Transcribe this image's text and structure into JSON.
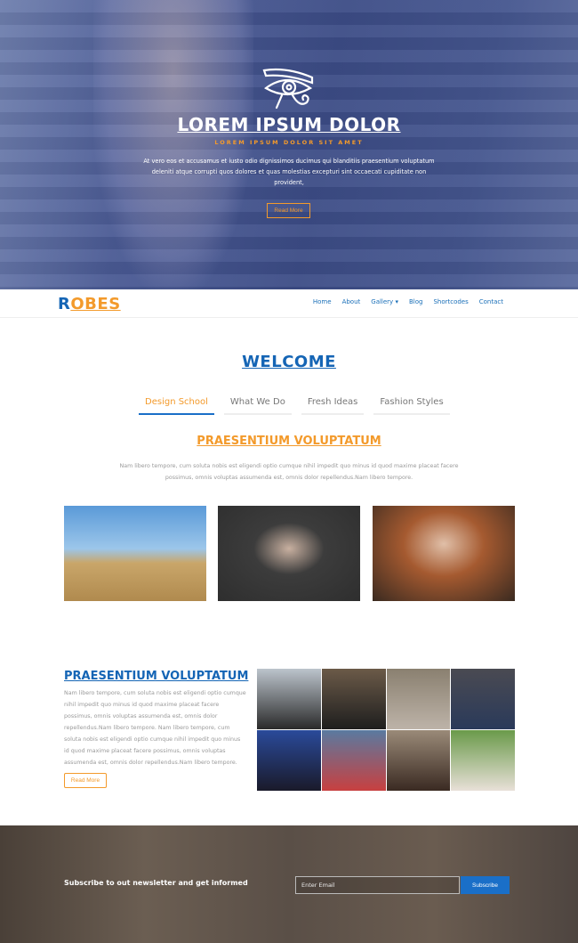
{
  "hero": {
    "title": "LOREM IPSUM DOLOR",
    "subtitle": "LOREM IPSUM DOLOR SIT AMET",
    "text": "At vero eos et accusamus et iusto odio dignissimos ducimus qui blanditiis praesentium voluptatum deleniti atque corrupti quos dolores et quas molestias excepturi sint occaecati cupiditate non provident,",
    "button": "Read More",
    "icon": "eye-of-horus-icon"
  },
  "nav": {
    "logo_first": "R",
    "logo_rest": "OBES",
    "links": [
      "Home",
      "About",
      "Gallery",
      "Blog",
      "Shortcodes",
      "Contact"
    ],
    "dropdown_caret": "▾"
  },
  "welcome": {
    "title": "WELCOME",
    "tabs": [
      "Design School",
      "What We Do",
      "Fresh Ideas",
      "Fashion Styles"
    ],
    "active_tab": "Design School",
    "heading": "PRAESENTIUM VOLUPTATUM",
    "text": "Nam libero tempore, cum soluta nobis est eligendi optio cumque nihil impedit quo minus id quod maxime placeat facere possimus, omnis voluptas assumenda est, omnis dolor repellendus.Nam libero tempore."
  },
  "feature": {
    "heading": "PRAESENTIUM VOLUPTATUM",
    "text": "Nam libero tempore, cum soluta nobis est eligendi optio cumque nihil impedit quo minus id quod maxime placeat facere possimus, omnis voluptas assumenda est, omnis dolor repellendus.Nam libero tempore. Nam libero tempore, cum soluta nobis est eligendi optio cumque nihil impedit quo minus id quod maxime placeat facere possimus, omnis voluptas assumenda est, omnis dolor repellendus.Nam libero tempore.",
    "button": "Read More"
  },
  "newsletter": {
    "text": "Subscribe to out newsletter and get informed",
    "placeholder": "Enter Email",
    "button": "Subscribe"
  },
  "colors": {
    "brand_blue": "#1565b5",
    "accent_orange": "#f39a2b",
    "button_blue": "#1a6fc8"
  }
}
